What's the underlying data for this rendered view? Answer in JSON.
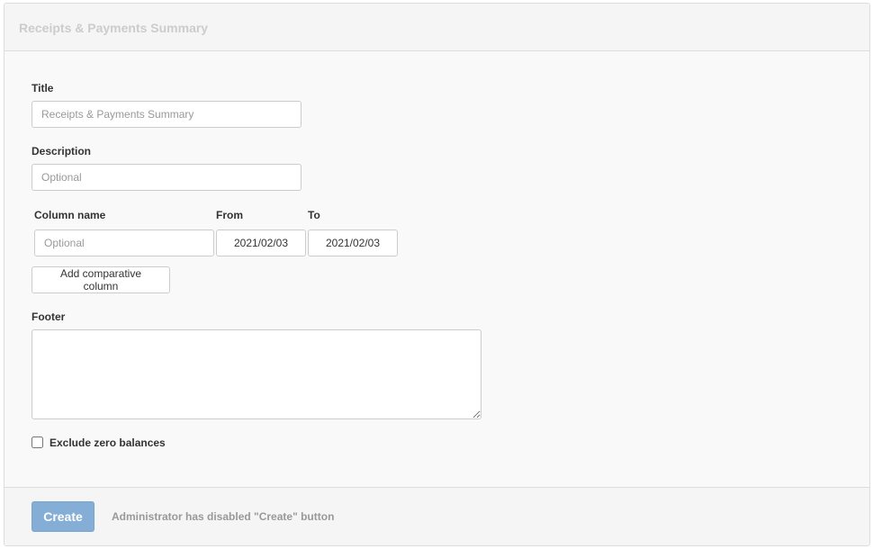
{
  "panel": {
    "title": "Receipts & Payments Summary"
  },
  "form": {
    "title_label": "Title",
    "title_placeholder": "Receipts & Payments Summary",
    "description_label": "Description",
    "description_placeholder": "Optional",
    "columns": {
      "name_header": "Column name",
      "from_header": "From",
      "to_header": "To",
      "name_placeholder": "Optional",
      "from_value": "2021/02/03",
      "to_value": "2021/02/03"
    },
    "add_column_label": "Add comparative column",
    "footer_label": "Footer",
    "footer_value": "",
    "exclude_zero_label": "Exclude zero balances",
    "exclude_zero_checked": false
  },
  "footer": {
    "create_label": "Create",
    "note": "Administrator has disabled \"Create\" button"
  }
}
